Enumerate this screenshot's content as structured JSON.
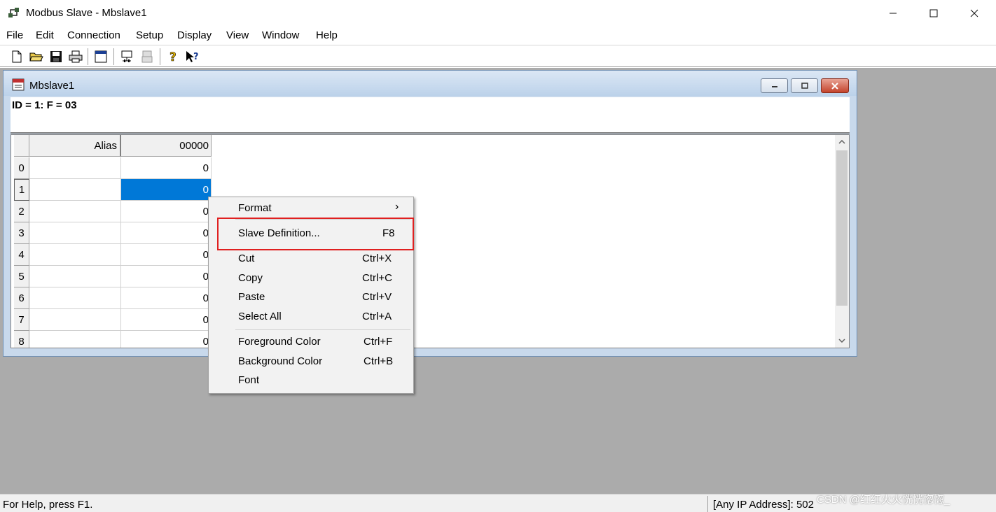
{
  "window": {
    "title": "Modbus Slave - Mbslave1",
    "min_label": "—",
    "max_label": "☐",
    "close_label": "✕"
  },
  "menubar": [
    "File",
    "Edit",
    "Connection",
    "Setup",
    "Display",
    "View",
    "Window",
    "Help"
  ],
  "child": {
    "title": "Mbslave1",
    "id_line": "ID = 1: F = 03",
    "headers": {
      "alias": "Alias",
      "col0": "00000"
    },
    "rows": [
      {
        "index": "0",
        "value": "0"
      },
      {
        "index": "1",
        "value": "0"
      },
      {
        "index": "2",
        "value": "0"
      },
      {
        "index": "3",
        "value": "0"
      },
      {
        "index": "4",
        "value": "0"
      },
      {
        "index": "5",
        "value": "0"
      },
      {
        "index": "6",
        "value": "0"
      },
      {
        "index": "7",
        "value": "0"
      },
      {
        "index": "8",
        "value": "0"
      }
    ],
    "selected_row": "1"
  },
  "context_menu": {
    "format": {
      "label": "Format",
      "arrow": "›"
    },
    "slave_definition": {
      "label": "Slave Definition...",
      "shortcut": "F8"
    },
    "cut": {
      "label": "Cut",
      "shortcut": "Ctrl+X"
    },
    "copy": {
      "label": "Copy",
      "shortcut": "Ctrl+C"
    },
    "paste": {
      "label": "Paste",
      "shortcut": "Ctrl+V"
    },
    "select_all": {
      "label": "Select All",
      "shortcut": "Ctrl+A"
    },
    "foreground": {
      "label": "Foreground Color",
      "shortcut": "Ctrl+F"
    },
    "background": {
      "label": "Background Color",
      "shortcut": "Ctrl+B"
    },
    "font": {
      "label": "Font"
    }
  },
  "status": {
    "left": "For Help, press F1.",
    "right": "[Any IP Address]: 502"
  },
  "watermark": "CSDN @红红火火恍恍惚惚_",
  "colors": {
    "selection": "#0078d7",
    "highlight_box": "#e02020",
    "mdi_background": "#ababab"
  }
}
